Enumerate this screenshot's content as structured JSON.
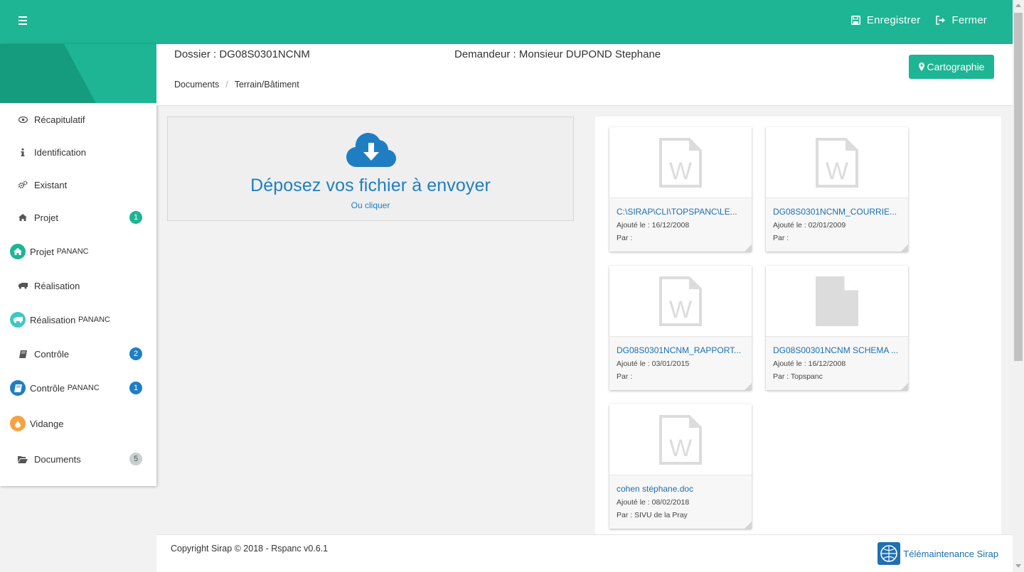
{
  "topbar": {
    "menu_icon": "hamburger-icon",
    "save_label": "Enregistrer",
    "close_label": "Fermer"
  },
  "header": {
    "dossier": "Dossier : DG08S0301NCNM",
    "demandeur": "Demandeur : Monsieur DUPOND  Stephane",
    "breadcrumb": [
      "Documents",
      "Terrain/Bâtiment"
    ],
    "carto_label": "Cartographie"
  },
  "sidebar": {
    "items": [
      {
        "label": "Récapitulatif",
        "icon": "eye-icon"
      },
      {
        "label": "Identification",
        "icon": "info-icon"
      },
      {
        "label": "Existant",
        "icon": "gears-icon"
      },
      {
        "label": "Projet",
        "icon": "home-icon",
        "badge": "1",
        "badge_color": "#1db594"
      },
      {
        "label": "Projet",
        "suffix": "PANANC",
        "icon": "home-circle-icon"
      },
      {
        "label": "Réalisation",
        "icon": "truck-icon"
      },
      {
        "label": "Réalisation",
        "suffix": "PANANC",
        "icon": "truck-circle-icon"
      },
      {
        "label": "Contrôle",
        "icon": "book-icon",
        "badge": "2",
        "badge_color": "#1f7ec2"
      },
      {
        "label": "Contrôle",
        "suffix": "PANANC",
        "icon": "book-circle-icon",
        "badge": "1",
        "badge_color": "#1f7ec2"
      },
      {
        "label": "Vidange",
        "icon": "drop-circle-icon"
      },
      {
        "label": "Documents",
        "icon": "folder-open-icon",
        "badge": "5",
        "badge_color": "#c9ced1"
      }
    ]
  },
  "dropzone": {
    "title": "Déposez vos fichier à envoyer",
    "subtitle": "Ou cliquer"
  },
  "files": [
    {
      "name": "C:\\SIRAP\\CLI\\TOPSPANC\\LE...",
      "date": "Ajouté le : 16/12/2008",
      "by": "Par :",
      "type": "word"
    },
    {
      "name": "DG08S0301NCNM_COURRIE...",
      "date": "Ajouté le : 02/01/2009",
      "by": "Par :",
      "type": "word"
    },
    {
      "name": "DG08S0301NCNM_RAPPORT...",
      "date": "Ajouté le : 03/01/2015",
      "by": "Par :",
      "type": "word"
    },
    {
      "name": "DG08S00301NCNM SCHEMA ...",
      "date": "Ajouté le : 16/12/2008",
      "by": "Par : Topspanc",
      "type": "generic"
    },
    {
      "name": "cohen stéphane.doc",
      "date": "Ajouté le : 08/02/2018",
      "by": "Par : SIVU de la Pray",
      "type": "word"
    }
  ],
  "footer": {
    "copyright": "Copyright Sirap © 2018 - Rspanc v0.6.1",
    "tele_label": "Télémaintenance Sirap"
  }
}
